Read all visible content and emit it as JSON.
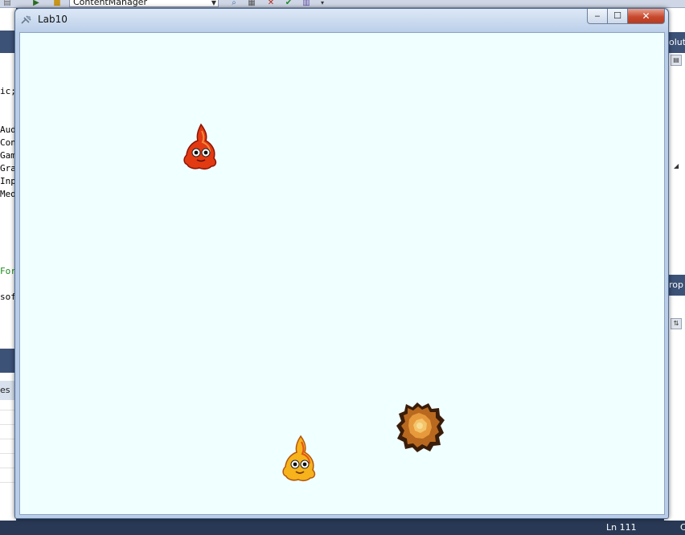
{
  "ide": {
    "combo_value": "ContentManager",
    "code_fragments": [
      "ic;",
      "Aud",
      "Con",
      "Gam",
      "Gra",
      "Inp",
      "Med",
      "For",
      "sof"
    ],
    "left_tab_label": "es",
    "right_panels": {
      "solution_label": "olut",
      "properties_label": "rop"
    },
    "status": {
      "line_label": "Ln 111",
      "col_label": "C"
    }
  },
  "window": {
    "title": "Lab10",
    "buttons": {
      "minimize": "‒",
      "maximize": "☐",
      "close": "✕"
    },
    "background_color": "#F0FFFF"
  },
  "game": {
    "sprites": [
      {
        "name": "red-flame-creature",
        "color": "#e23a12"
      },
      {
        "name": "yellow-flame-creature",
        "color": "#f6b31c"
      },
      {
        "name": "explosion",
        "color": "#b8691f"
      }
    ]
  }
}
